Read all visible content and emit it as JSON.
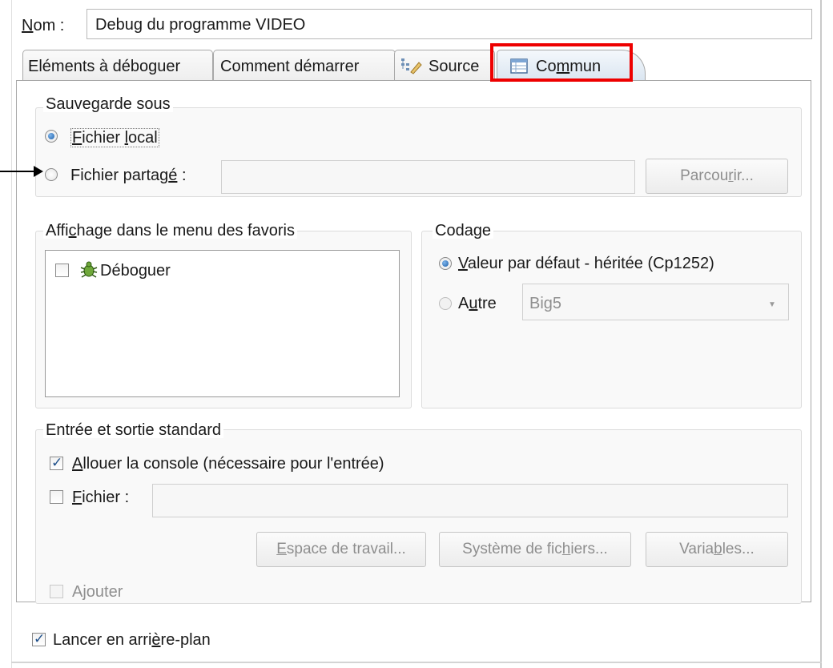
{
  "name_field": {
    "label_first": "N",
    "label_rest": "om :",
    "value": "Debug du programme VIDEO"
  },
  "tabs": [
    {
      "label": "Eléments à déboguer"
    },
    {
      "label": "Comment démarrer"
    },
    {
      "label": "Source"
    },
    {
      "label_pre": "Co",
      "label_u": "m",
      "label_post": "mun"
    }
  ],
  "save_as": {
    "title": "Sauvegarde sous",
    "local": {
      "u": "F",
      "rest": "ichier ",
      "u2": "l",
      "rest2": "ocal",
      "checked": true
    },
    "shared": {
      "pre": "Fichier partag",
      "u": "é",
      "post": " :",
      "checked": false
    },
    "browse": {
      "pre": "Parcou",
      "u": "r",
      "post": "ir..."
    }
  },
  "favorites": {
    "title_pre": "Affi",
    "title_u": "c",
    "title_post": "hage dans le menu des favoris",
    "items": [
      {
        "label": "Déboguer",
        "checked": false
      }
    ]
  },
  "encoding": {
    "title": "Codage",
    "default": {
      "u": "V",
      "rest": "aleur par défaut - héritée (Cp1252)",
      "checked": true
    },
    "other": {
      "pre": "A",
      "u": "u",
      "post": "tre",
      "checked": false,
      "value": "Big5"
    }
  },
  "std_io": {
    "title": "Entrée et sortie standard",
    "allocate": {
      "u": "A",
      "rest": "llouer la console (nécessaire pour l'entrée)",
      "checked": true
    },
    "file": {
      "u": "F",
      "rest": "ichier :",
      "checked": false
    },
    "buttons": {
      "workspace": {
        "u": "E",
        "rest": "space de travail..."
      },
      "filesystem": {
        "pre": "Système de fic",
        "u": "h",
        "post": "iers..."
      },
      "variables": {
        "pre": "Varia",
        "u": "b",
        "post": "les..."
      }
    },
    "append": {
      "label": "Ajouter",
      "checked": false
    }
  },
  "background": {
    "pre": "Lancer en arri",
    "u": "è",
    "post": "re-plan",
    "checked": true
  },
  "colors": {
    "highlight": "#ee0000",
    "radio_selected": "#1e5fa8"
  }
}
